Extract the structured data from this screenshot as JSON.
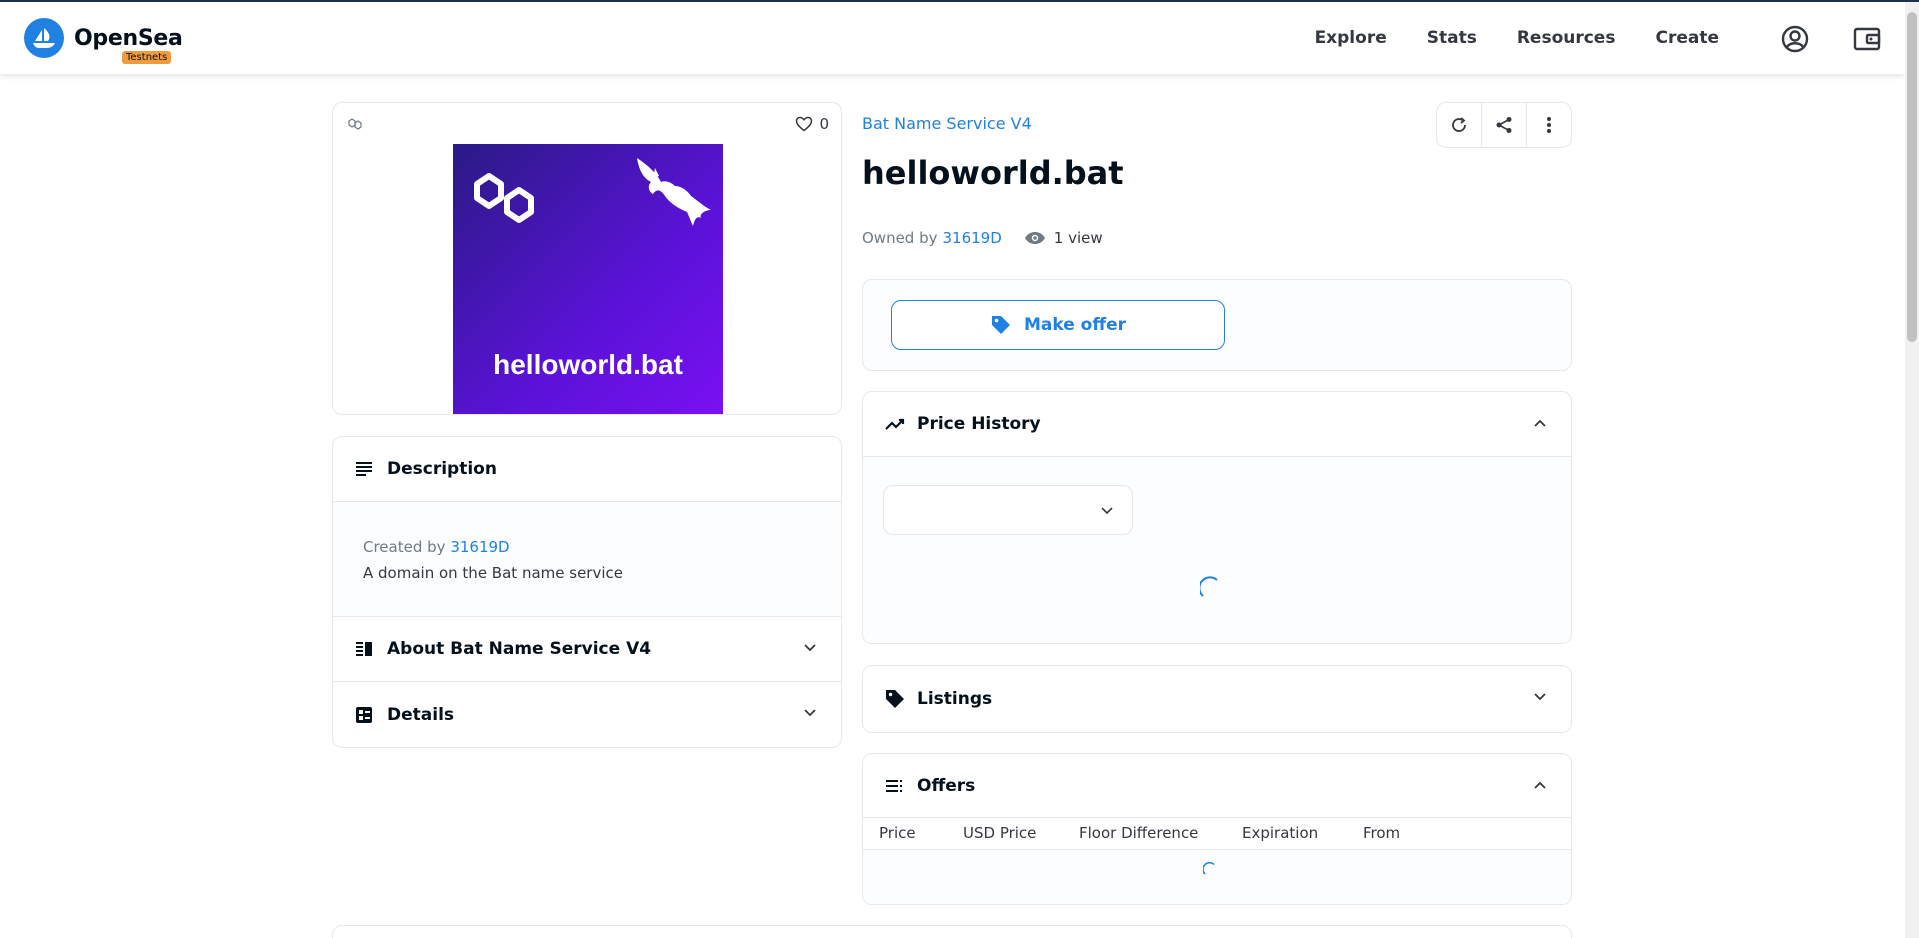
{
  "header": {
    "brand": "OpenSea",
    "badge": "Testnets",
    "nav": [
      "Explore",
      "Stats",
      "Resources",
      "Create"
    ]
  },
  "media": {
    "likes": "0",
    "image_text": "helloworld.bat"
  },
  "description": {
    "heading": "Description",
    "created_by_label": "Created by",
    "creator": "31619D",
    "text": "A domain on the Bat name service"
  },
  "about": {
    "heading": "About Bat Name Service V4"
  },
  "details": {
    "heading": "Details"
  },
  "item": {
    "collection": "Bat Name Service V4",
    "title": "helloworld.bat",
    "owned_by_label": "Owned by",
    "owner": "31619D",
    "views": "1 view"
  },
  "offer": {
    "button_label": "Make offer"
  },
  "price_history": {
    "heading": "Price History"
  },
  "listings": {
    "heading": "Listings"
  },
  "offers": {
    "heading": "Offers",
    "columns": [
      "Price",
      "USD Price",
      "Floor Difference",
      "Expiration",
      "From"
    ]
  },
  "colors": {
    "accent": "#2081e2",
    "badge": "#f19b3f",
    "image_gradient_start": "#2a1a85",
    "image_gradient_end": "#7a10f2"
  }
}
